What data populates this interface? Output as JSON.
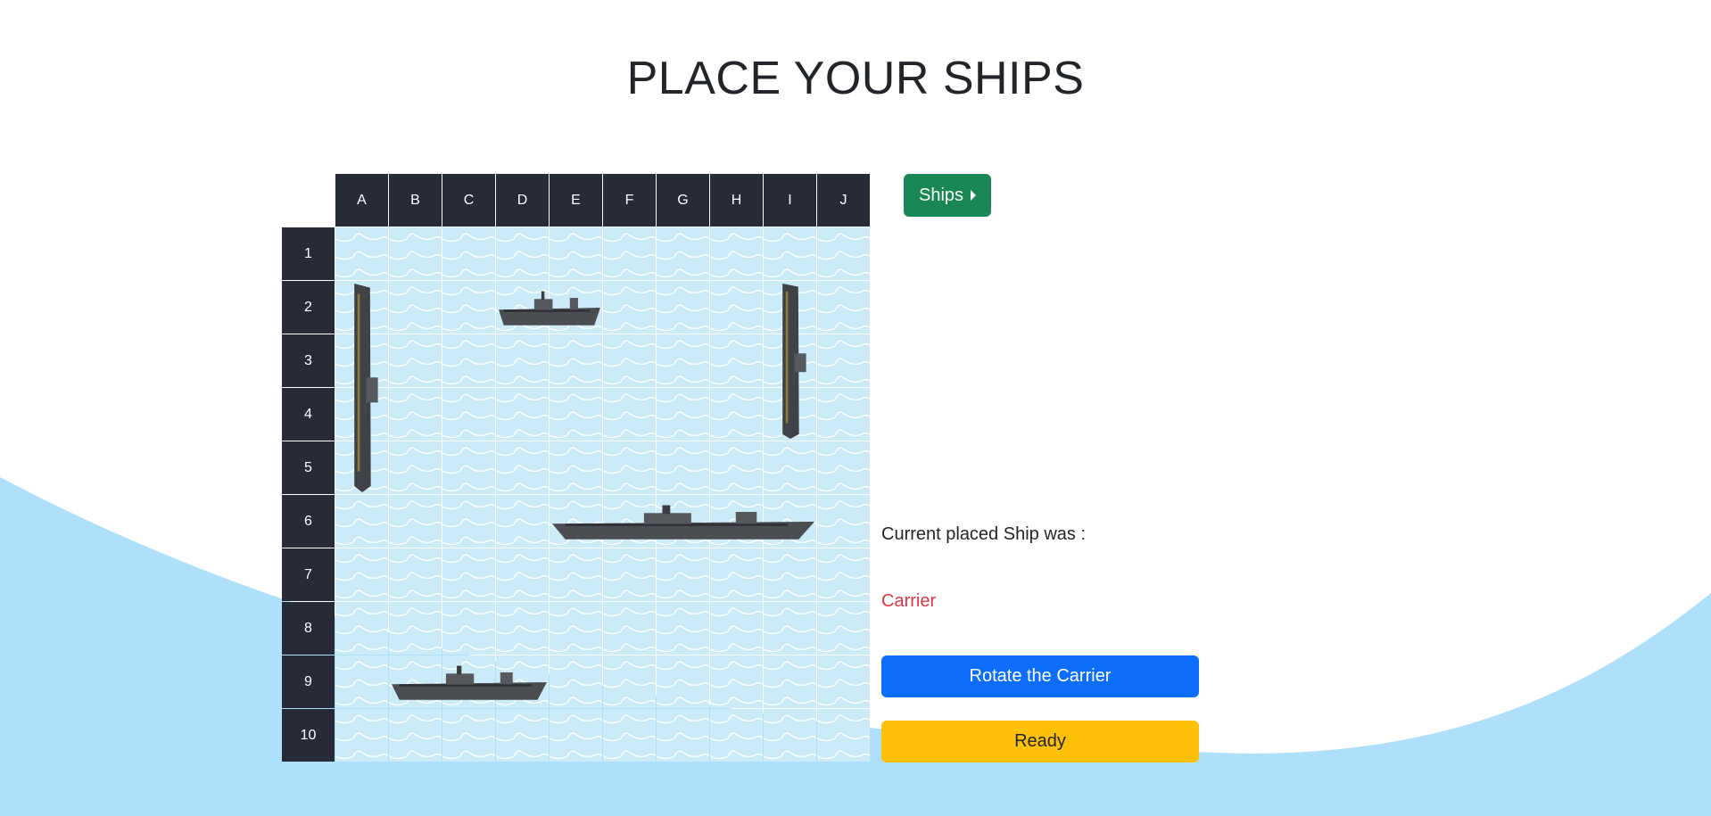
{
  "page": {
    "title": "PLACE YOUR SHIPS"
  },
  "board": {
    "columns": [
      "A",
      "B",
      "C",
      "D",
      "E",
      "F",
      "G",
      "H",
      "I",
      "J"
    ],
    "rows": [
      "1",
      "2",
      "3",
      "4",
      "5",
      "6",
      "7",
      "8",
      "9",
      "10"
    ]
  },
  "ships": [
    {
      "icon": "battleship-vertical-icon",
      "start": "A2",
      "length": 4,
      "orientation": "vertical"
    },
    {
      "icon": "destroyer-icon",
      "start": "D2",
      "length": 2,
      "orientation": "horizontal"
    },
    {
      "icon": "submarine-vertical-icon",
      "start": "I2",
      "length": 3,
      "orientation": "vertical"
    },
    {
      "icon": "carrier-icon",
      "start": "E6",
      "length": 5,
      "orientation": "horizontal"
    },
    {
      "icon": "cruiser-icon",
      "start": "B9",
      "length": 3,
      "orientation": "horizontal"
    }
  ],
  "sidebar": {
    "ships_button_label": "Ships",
    "current_placed_label": "Current placed Ship was :",
    "current_placed_ship": "Carrier",
    "rotate_button_label": "Rotate the Carrier",
    "ready_button_label": "Ready"
  },
  "colors": {
    "header_bg": "#272b38",
    "water": "#caebf7",
    "wave_background": "#aedffb",
    "ships_button": "#198754",
    "rotate_button": "#0d6efd",
    "ready_button": "#ffc107",
    "placed_ship_text": "#dc3545"
  }
}
